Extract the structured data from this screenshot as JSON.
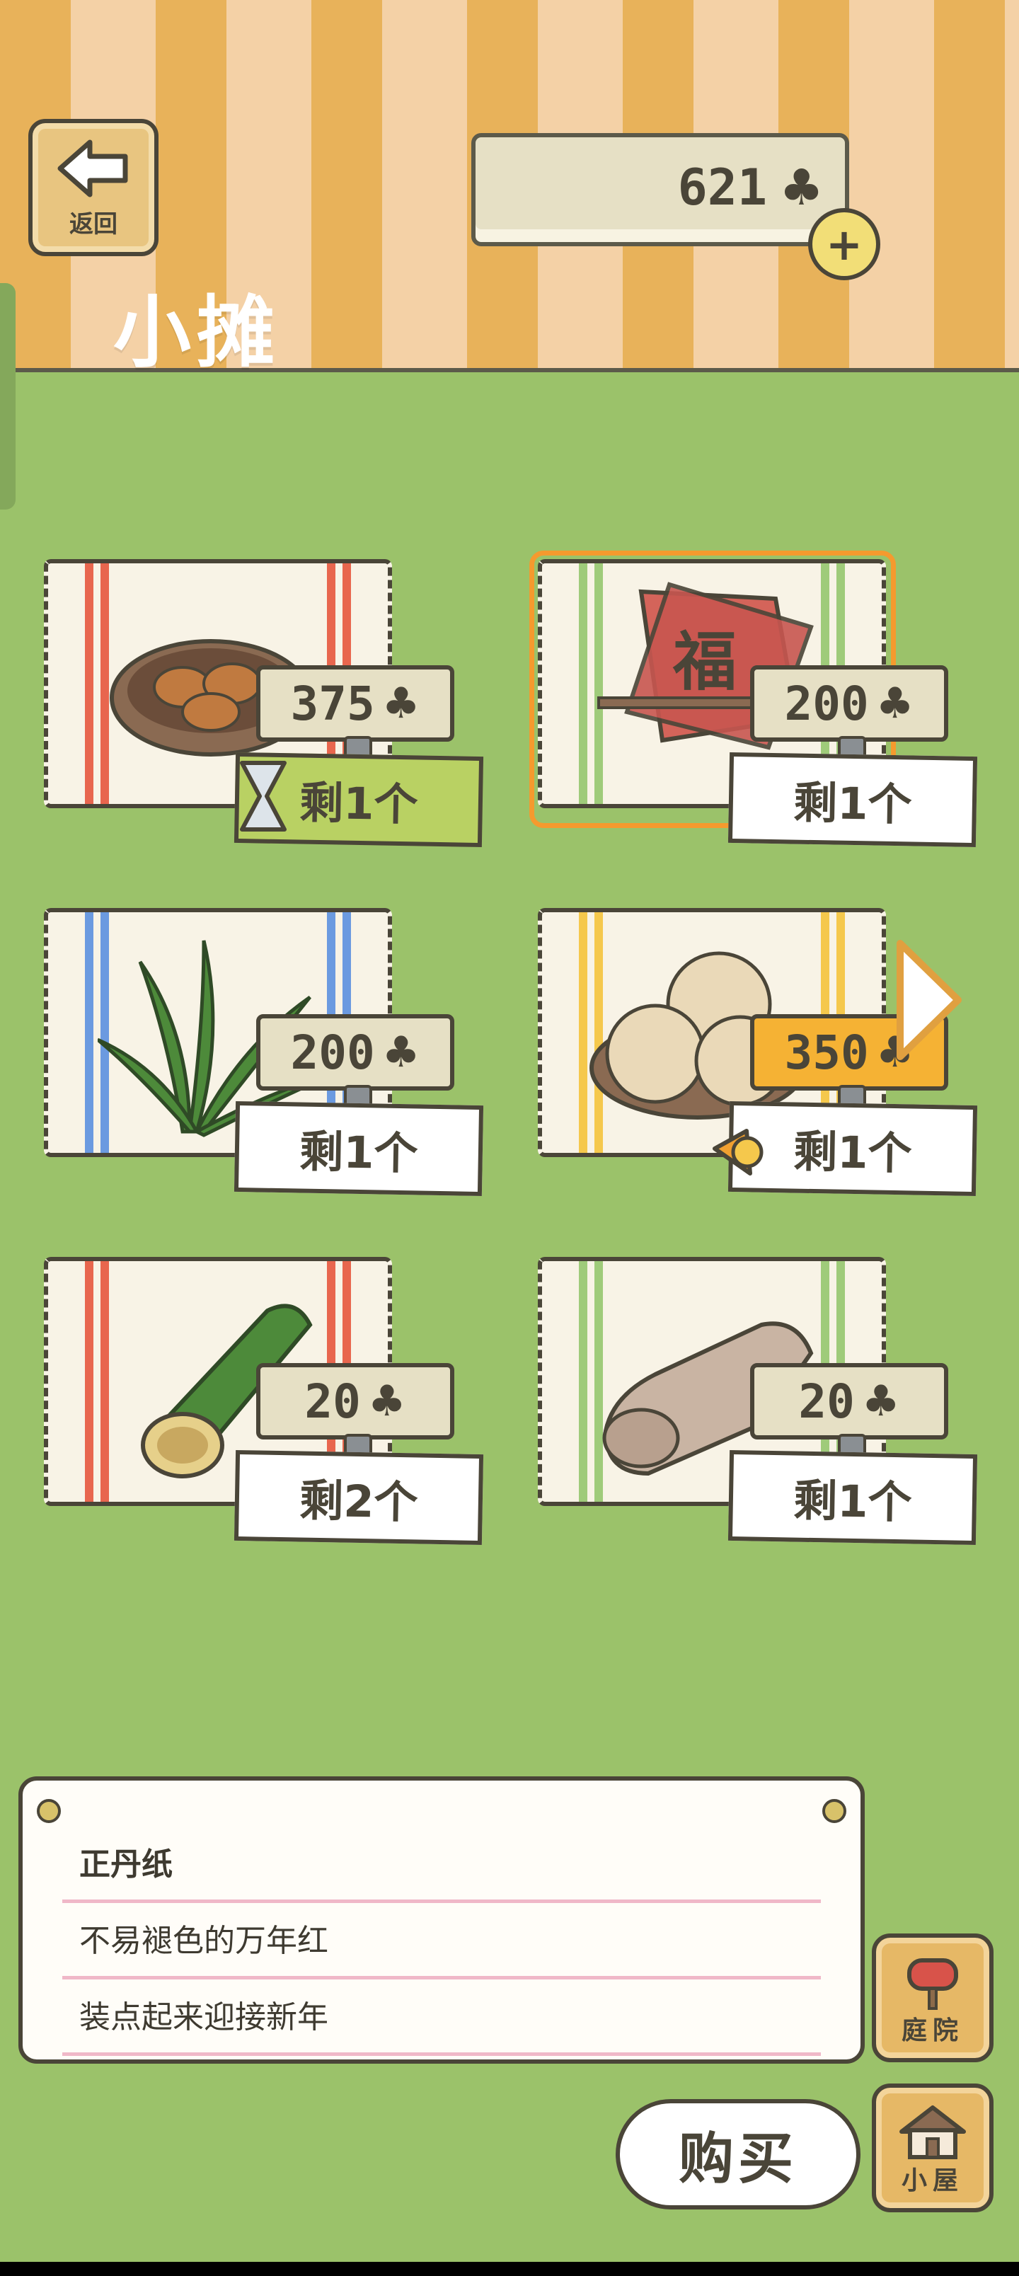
{
  "header": {
    "back_label": "返回",
    "currency_value": "621",
    "currency_icon": "clover-icon",
    "title": "小摊"
  },
  "items": [
    {
      "name": "dumplings",
      "price": "375",
      "remaining": "剩1个",
      "stripe_color": "#e8664e",
      "highlighted": false,
      "timed": true
    },
    {
      "name": "red-paper",
      "price": "200",
      "remaining": "剩1个",
      "stripe_color": "#9fcb7a",
      "highlighted": true,
      "timed": false
    },
    {
      "name": "leaves",
      "price": "200",
      "remaining": "剩1个",
      "stripe_color": "#6b9ae0",
      "highlighted": false,
      "timed": false
    },
    {
      "name": "buns",
      "price": "350",
      "remaining": "剩1个",
      "stripe_color": "#f5c84c",
      "highlighted": false,
      "timed": true
    },
    {
      "name": "bamboo",
      "price": "20",
      "remaining": "剩2个",
      "stripe_color": "#e8664e",
      "highlighted": false,
      "timed": false
    },
    {
      "name": "cloth",
      "price": "20",
      "remaining": "剩1个",
      "stripe_color": "#9fcb7a",
      "highlighted": false,
      "timed": false
    }
  ],
  "description": {
    "title": "正丹纸",
    "line1": "不易褪色的万年红",
    "line2": "装点起来迎接新年"
  },
  "buttons": {
    "yard": "庭院",
    "house": "小屋",
    "buy": "购买"
  },
  "colors": {
    "grass": "#9bc26a",
    "header_stripe_dark": "#e8b25a",
    "header_stripe_light": "#f4d1a6",
    "highlight": "#f59a2e",
    "sale_tag": "#f5b234",
    "timed_tag": "#b9d163"
  }
}
